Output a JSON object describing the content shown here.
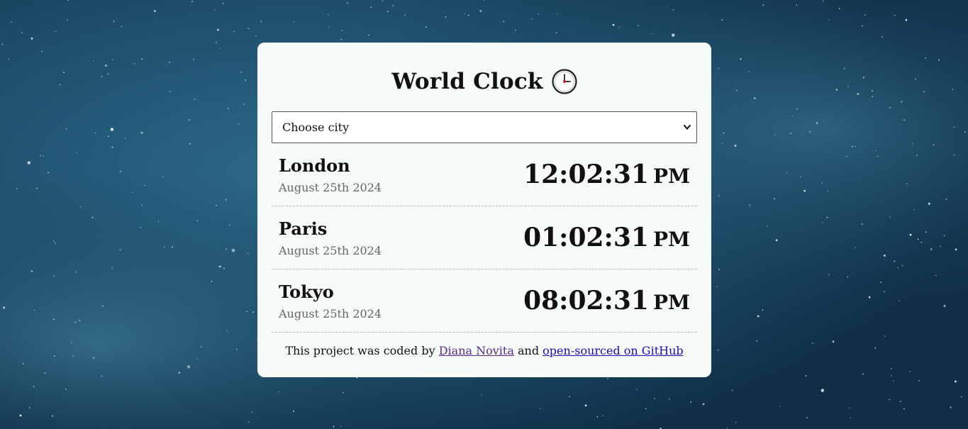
{
  "app": {
    "title": "World Clock",
    "title_icon": "clock-icon"
  },
  "city_select": {
    "selected": "Choose city",
    "options": [
      "Choose city"
    ]
  },
  "cities": [
    {
      "name": "London",
      "date": "August 25th 2024",
      "time": "12:02:31",
      "ampm": "PM"
    },
    {
      "name": "Paris",
      "date": "August 25th 2024",
      "time": "01:02:31",
      "ampm": "PM"
    },
    {
      "name": "Tokyo",
      "date": "August 25th 2024",
      "time": "08:02:31",
      "ampm": "PM"
    }
  ],
  "footer": {
    "prefix": "This project was coded by",
    "author_link": "Diana Novita",
    "middle": "and",
    "github_link": "open-sourced on GitHub"
  },
  "colors": {
    "background": "#1d4e6a",
    "card": "#f6faf8",
    "text": "#111111",
    "muted": "#666666",
    "visited_link": "#5b2b87",
    "link": "#1a0dab"
  }
}
